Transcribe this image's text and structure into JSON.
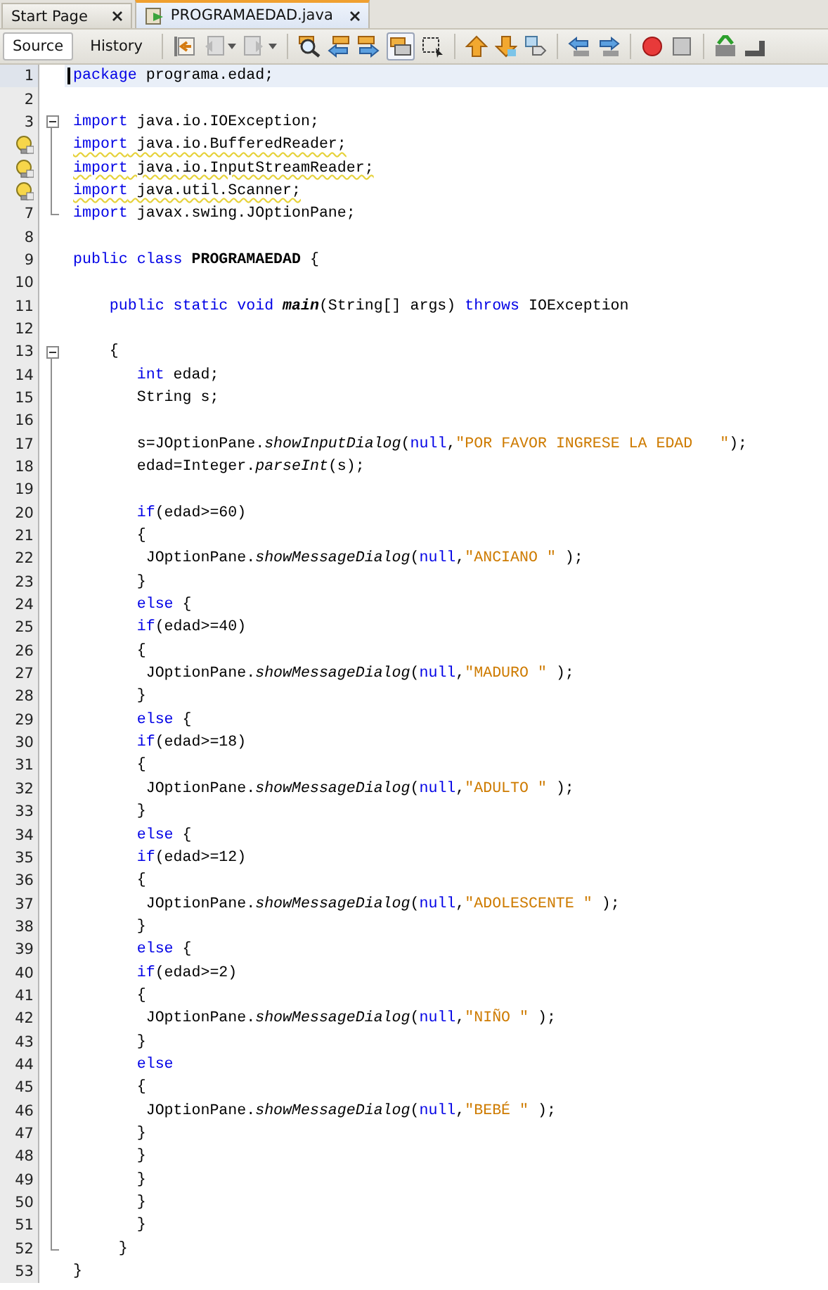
{
  "file_tabs": [
    {
      "label": "Start Page",
      "selected": false
    },
    {
      "label": "PROGRAMAEDAD.java",
      "selected": true
    }
  ],
  "view_tabs": [
    {
      "label": "Source",
      "selected": true
    },
    {
      "label": "History",
      "selected": false
    }
  ],
  "lines": [
    {
      "number": "1",
      "current": true,
      "tokens": [
        {
          "kind": "keyword",
          "text": "package"
        },
        {
          "kind": "plain",
          "text": " programa.edad;"
        }
      ]
    },
    {
      "number": "2",
      "current": false
    },
    {
      "number": "3",
      "current": false,
      "fold_start": true,
      "tokens": [
        {
          "kind": "keyword",
          "text": "import"
        },
        {
          "kind": "plain",
          "text": " java.io.IOException;"
        }
      ]
    },
    {
      "current": false,
      "warning": true,
      "tokens": [
        {
          "kind": "keyword",
          "text": "import"
        },
        {
          "kind": "plain",
          "text": " java.io.BufferedReader;"
        }
      ]
    },
    {
      "current": false,
      "warning": true,
      "tokens": [
        {
          "kind": "keyword",
          "text": "import"
        },
        {
          "kind": "plain",
          "text": " java.io.InputStreamReader;"
        }
      ]
    },
    {
      "current": false,
      "warning": true,
      "tokens": [
        {
          "kind": "keyword",
          "text": "import"
        },
        {
          "kind": "plain",
          "text": " java.util.Scanner;"
        }
      ]
    },
    {
      "number": "7",
      "current": false,
      "fold_end": true,
      "tokens": [
        {
          "kind": "keyword",
          "text": "import"
        },
        {
          "kind": "plain",
          "text": " javax.swing.JOptionPane;"
        }
      ]
    },
    {
      "number": "8",
      "current": false
    },
    {
      "number": "9",
      "current": false,
      "tokens": [
        {
          "kind": "keyword",
          "text": "public class"
        },
        {
          "kind": "bold",
          "text": " PROGRAMAEDAD"
        },
        {
          "kind": "plain",
          "text": " {"
        }
      ]
    },
    {
      "number": "10",
      "current": false
    },
    {
      "number": "11",
      "current": false,
      "tokens": [
        {
          "kind": "keyword",
          "text": "    public static void"
        },
        {
          "kind": "bold-method",
          "text": " main"
        },
        {
          "kind": "plain",
          "text": "(String[] args) "
        },
        {
          "kind": "keyword",
          "text": "throws"
        },
        {
          "kind": "plain",
          "text": " IOException"
        }
      ]
    },
    {
      "number": "12",
      "current": false
    },
    {
      "number": "13",
      "current": false,
      "fold_start": true,
      "tokens": [
        {
          "kind": "plain",
          "text": "    {"
        }
      ]
    },
    {
      "number": "14",
      "current": false,
      "tokens": [
        {
          "kind": "keyword",
          "text": "       int"
        },
        {
          "kind": "plain",
          "text": " edad;"
        }
      ]
    },
    {
      "number": "15",
      "current": false,
      "tokens": [
        {
          "kind": "plain",
          "text": "       String s;"
        }
      ]
    },
    {
      "number": "16",
      "current": false
    },
    {
      "number": "17",
      "current": false,
      "tokens": [
        {
          "kind": "plain",
          "text": "       s=JOptionPane."
        },
        {
          "kind": "method",
          "text": "showInputDialog"
        },
        {
          "kind": "plain",
          "text": "("
        },
        {
          "kind": "keyword",
          "text": "null"
        },
        {
          "kind": "plain",
          "text": ","
        },
        {
          "kind": "string",
          "text": "\"POR FAVOR INGRESE LA EDAD   \""
        },
        {
          "kind": "plain",
          "text": ");"
        }
      ]
    },
    {
      "number": "18",
      "current": false,
      "tokens": [
        {
          "kind": "plain",
          "text": "       edad=Integer."
        },
        {
          "kind": "method",
          "text": "parseInt"
        },
        {
          "kind": "plain",
          "text": "(s);"
        }
      ]
    },
    {
      "number": "19",
      "current": false
    },
    {
      "number": "20",
      "current": false,
      "tokens": [
        {
          "kind": "keyword",
          "text": "       if"
        },
        {
          "kind": "plain",
          "text": "(edad>=60)"
        }
      ]
    },
    {
      "number": "21",
      "current": false,
      "tokens": [
        {
          "kind": "plain",
          "text": "       {"
        }
      ]
    },
    {
      "number": "22",
      "current": false,
      "tokens": [
        {
          "kind": "plain",
          "text": "        JOptionPane."
        },
        {
          "kind": "method",
          "text": "showMessageDialog"
        },
        {
          "kind": "plain",
          "text": "("
        },
        {
          "kind": "keyword",
          "text": "null"
        },
        {
          "kind": "plain",
          "text": ","
        },
        {
          "kind": "string",
          "text": "\"ANCIANO \""
        },
        {
          "kind": "plain",
          "text": " );"
        }
      ]
    },
    {
      "number": "23",
      "current": false,
      "tokens": [
        {
          "kind": "plain",
          "text": "       }"
        }
      ]
    },
    {
      "number": "24",
      "current": false,
      "tokens": [
        {
          "kind": "keyword",
          "text": "       else"
        },
        {
          "kind": "plain",
          "text": " {"
        }
      ]
    },
    {
      "number": "25",
      "current": false,
      "tokens": [
        {
          "kind": "keyword",
          "text": "       if"
        },
        {
          "kind": "plain",
          "text": "(edad>=40)"
        }
      ]
    },
    {
      "number": "26",
      "current": false,
      "tokens": [
        {
          "kind": "plain",
          "text": "       {"
        }
      ]
    },
    {
      "number": "27",
      "current": false,
      "tokens": [
        {
          "kind": "plain",
          "text": "        JOptionPane."
        },
        {
          "kind": "method",
          "text": "showMessageDialog"
        },
        {
          "kind": "plain",
          "text": "("
        },
        {
          "kind": "keyword",
          "text": "null"
        },
        {
          "kind": "plain",
          "text": ","
        },
        {
          "kind": "string",
          "text": "\"MADURO \""
        },
        {
          "kind": "plain",
          "text": " );"
        }
      ]
    },
    {
      "number": "28",
      "current": false,
      "tokens": [
        {
          "kind": "plain",
          "text": "       }"
        }
      ]
    },
    {
      "number": "29",
      "current": false,
      "tokens": [
        {
          "kind": "keyword",
          "text": "       else"
        },
        {
          "kind": "plain",
          "text": " {"
        }
      ]
    },
    {
      "number": "30",
      "current": false,
      "tokens": [
        {
          "kind": "keyword",
          "text": "       if"
        },
        {
          "kind": "plain",
          "text": "(edad>=18)"
        }
      ]
    },
    {
      "number": "31",
      "current": false,
      "tokens": [
        {
          "kind": "plain",
          "text": "       {"
        }
      ]
    },
    {
      "number": "32",
      "current": false,
      "tokens": [
        {
          "kind": "plain",
          "text": "        JOptionPane."
        },
        {
          "kind": "method",
          "text": "showMessageDialog"
        },
        {
          "kind": "plain",
          "text": "("
        },
        {
          "kind": "keyword",
          "text": "null"
        },
        {
          "kind": "plain",
          "text": ","
        },
        {
          "kind": "string",
          "text": "\"ADULTO \""
        },
        {
          "kind": "plain",
          "text": " );"
        }
      ]
    },
    {
      "number": "33",
      "current": false,
      "tokens": [
        {
          "kind": "plain",
          "text": "       }"
        }
      ]
    },
    {
      "number": "34",
      "current": false,
      "tokens": [
        {
          "kind": "keyword",
          "text": "       else"
        },
        {
          "kind": "plain",
          "text": " {"
        }
      ]
    },
    {
      "number": "35",
      "current": false,
      "tokens": [
        {
          "kind": "keyword",
          "text": "       if"
        },
        {
          "kind": "plain",
          "text": "(edad>=12)"
        }
      ]
    },
    {
      "number": "36",
      "current": false,
      "tokens": [
        {
          "kind": "plain",
          "text": "       {"
        }
      ]
    },
    {
      "number": "37",
      "current": false,
      "tokens": [
        {
          "kind": "plain",
          "text": "        JOptionPane."
        },
        {
          "kind": "method",
          "text": "showMessageDialog"
        },
        {
          "kind": "plain",
          "text": "("
        },
        {
          "kind": "keyword",
          "text": "null"
        },
        {
          "kind": "plain",
          "text": ","
        },
        {
          "kind": "string",
          "text": "\"ADOLESCENTE \""
        },
        {
          "kind": "plain",
          "text": " );"
        }
      ]
    },
    {
      "number": "38",
      "current": false,
      "tokens": [
        {
          "kind": "plain",
          "text": "       }"
        }
      ]
    },
    {
      "number": "39",
      "current": false,
      "tokens": [
        {
          "kind": "keyword",
          "text": "       else"
        },
        {
          "kind": "plain",
          "text": " {"
        }
      ]
    },
    {
      "number": "40",
      "current": false,
      "tokens": [
        {
          "kind": "keyword",
          "text": "       if"
        },
        {
          "kind": "plain",
          "text": "(edad>=2)"
        }
      ]
    },
    {
      "number": "41",
      "current": false,
      "tokens": [
        {
          "kind": "plain",
          "text": "       {"
        }
      ]
    },
    {
      "number": "42",
      "current": false,
      "tokens": [
        {
          "kind": "plain",
          "text": "        JOptionPane."
        },
        {
          "kind": "method",
          "text": "showMessageDialog"
        },
        {
          "kind": "plain",
          "text": "("
        },
        {
          "kind": "keyword",
          "text": "null"
        },
        {
          "kind": "plain",
          "text": ","
        },
        {
          "kind": "string",
          "text": "\"NIÑO \""
        },
        {
          "kind": "plain",
          "text": " );"
        }
      ]
    },
    {
      "number": "43",
      "current": false,
      "tokens": [
        {
          "kind": "plain",
          "text": "       }"
        }
      ]
    },
    {
      "number": "44",
      "current": false,
      "tokens": [
        {
          "kind": "keyword",
          "text": "       else"
        }
      ]
    },
    {
      "number": "45",
      "current": false,
      "tokens": [
        {
          "kind": "plain",
          "text": "       {"
        }
      ]
    },
    {
      "number": "46",
      "current": false,
      "tokens": [
        {
          "kind": "plain",
          "text": "        JOptionPane."
        },
        {
          "kind": "method",
          "text": "showMessageDialog"
        },
        {
          "kind": "plain",
          "text": "("
        },
        {
          "kind": "keyword",
          "text": "null"
        },
        {
          "kind": "plain",
          "text": ","
        },
        {
          "kind": "string",
          "text": "\"BEBÉ \""
        },
        {
          "kind": "plain",
          "text": " );"
        }
      ]
    },
    {
      "number": "47",
      "current": false,
      "tokens": [
        {
          "kind": "plain",
          "text": "       }"
        }
      ]
    },
    {
      "number": "48",
      "current": false,
      "tokens": [
        {
          "kind": "plain",
          "text": "       }"
        }
      ]
    },
    {
      "number": "49",
      "current": false,
      "tokens": [
        {
          "kind": "plain",
          "text": "       }"
        }
      ]
    },
    {
      "number": "50",
      "current": false,
      "tokens": [
        {
          "kind": "plain",
          "text": "       }"
        }
      ]
    },
    {
      "number": "51",
      "current": false,
      "tokens": [
        {
          "kind": "plain",
          "text": "       }"
        }
      ]
    },
    {
      "number": "52",
      "current": false,
      "fold_end": true,
      "tokens": [
        {
          "kind": "plain",
          "text": "     }"
        }
      ]
    },
    {
      "number": "53",
      "current": false,
      "tokens": [
        {
          "kind": "plain",
          "text": "}"
        }
      ]
    }
  ]
}
